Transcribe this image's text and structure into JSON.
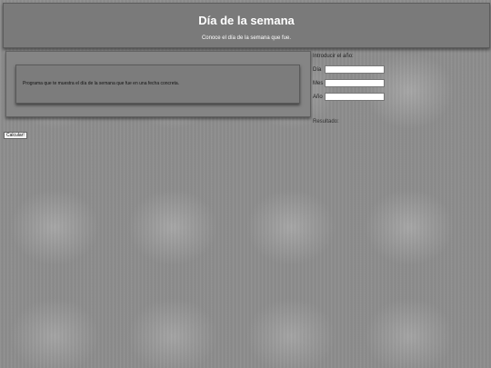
{
  "header": {
    "title": "Día de la semana",
    "subtitle": "Conoce el día de la semana que fue."
  },
  "main": {
    "description": "Programa que te muestra el día de la semana que fue en una fecha concreta."
  },
  "form": {
    "intro": "Introducir el año:",
    "fields": [
      {
        "label": "Día",
        "value": ""
      },
      {
        "label": "Mes",
        "value": ""
      },
      {
        "label": "Año",
        "value": ""
      }
    ],
    "result_label": "Resultado:"
  },
  "actions": {
    "calculate_label": "Calcular!"
  }
}
